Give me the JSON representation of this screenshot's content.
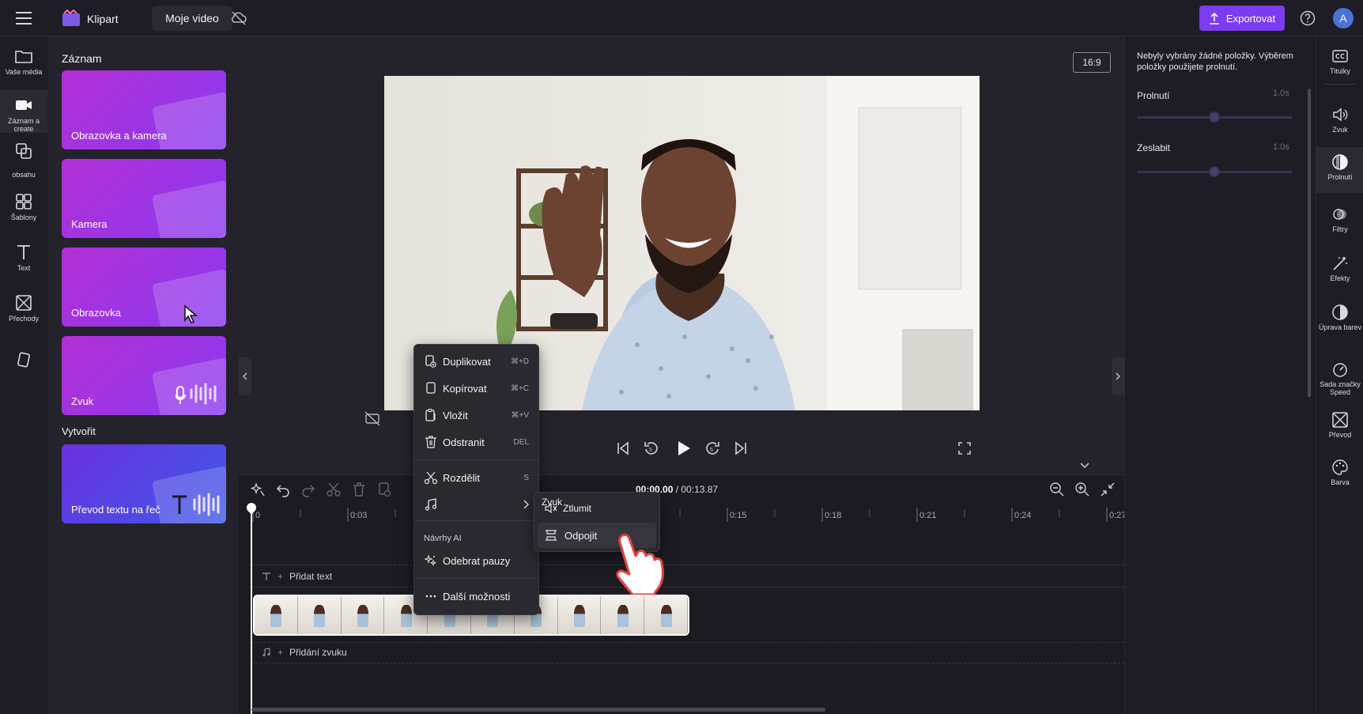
{
  "topbar": {
    "app_name": "Klipart",
    "project_name": "Moje video",
    "export_label": "Exportovat",
    "avatar_initial": "A"
  },
  "left_nav": {
    "items": [
      {
        "label": "Vaše média",
        "icon": "folder-icon"
      },
      {
        "label": "Záznam a create",
        "icon": "camera-record-icon"
      },
      {
        "label": "obsahu",
        "icon": "content-library-icon"
      },
      {
        "label": "Šablony",
        "icon": "templates-icon"
      },
      {
        "label": "Text",
        "icon": "text-icon"
      },
      {
        "label": "Přechody",
        "icon": "transitions-icon"
      },
      {
        "label": "",
        "icon": "brand-kit-icon"
      }
    ]
  },
  "library": {
    "record_title": "Záznam",
    "cards": [
      "Obrazovka a kamera",
      "Kamera",
      "Obrazovka",
      "Zvuk"
    ],
    "create_title": "Vytvořit",
    "create_card": "Převod textu na řeč"
  },
  "preview": {
    "aspect_ratio": "16:9"
  },
  "timeline": {
    "timecode_current": "00:00.00",
    "timecode_total": "/ 00:13.87",
    "ticks": [
      "0",
      "0:03",
      "0:15",
      "0:18",
      "0:21",
      "0:24",
      "0:27"
    ],
    "add_text_label": "Přidat text",
    "add_audio_label": "Přidání zvuku"
  },
  "context_menu": {
    "items": [
      {
        "label": "Duplikovat",
        "shortcut": "⌘+D"
      },
      {
        "label": "Kopírovat",
        "shortcut": "⌘+C"
      },
      {
        "label": "Vložit",
        "shortcut": "⌘+V"
      },
      {
        "label": "Odstranit",
        "shortcut": "DEL"
      },
      {
        "label": "Rozdělit",
        "shortcut": "S"
      }
    ],
    "ai_header": "Návrhy AI",
    "remove_pauses": "Odebrat pauzy",
    "more_options": "Další možnosti"
  },
  "submenu": {
    "title": "Zvuk",
    "mute": "Ztlumit",
    "detach": "Odpojit"
  },
  "properties": {
    "hint": "Nebyly vybrány žádné položky. Výběrem položky použijete prolnutí.",
    "fade_in_label": "Prolnutí",
    "fade_in_value": "1.0s",
    "fade_in_level": 0.5,
    "fade_out_label": "Zeslabit",
    "fade_out_value": "1.0s",
    "fade_out_level": 0.5
  },
  "tool_rail": {
    "items": [
      {
        "label": "Titulky",
        "icon": "captions-icon"
      },
      {
        "label": "Zvuk",
        "icon": "speaker-icon"
      },
      {
        "label": "Prolnutí",
        "icon": "fade-icon"
      },
      {
        "label": "Filtry",
        "icon": "filters-icon"
      },
      {
        "label": "Efekty",
        "icon": "effects-icon"
      },
      {
        "label": "Úprava barev",
        "icon": "color-adjust-icon"
      },
      {
        "label": "Sada značky Speed",
        "icon": "speed-icon"
      },
      {
        "label": "Převod",
        "icon": "transition-icon"
      },
      {
        "label": "Barva",
        "icon": "palette-icon"
      }
    ]
  }
}
